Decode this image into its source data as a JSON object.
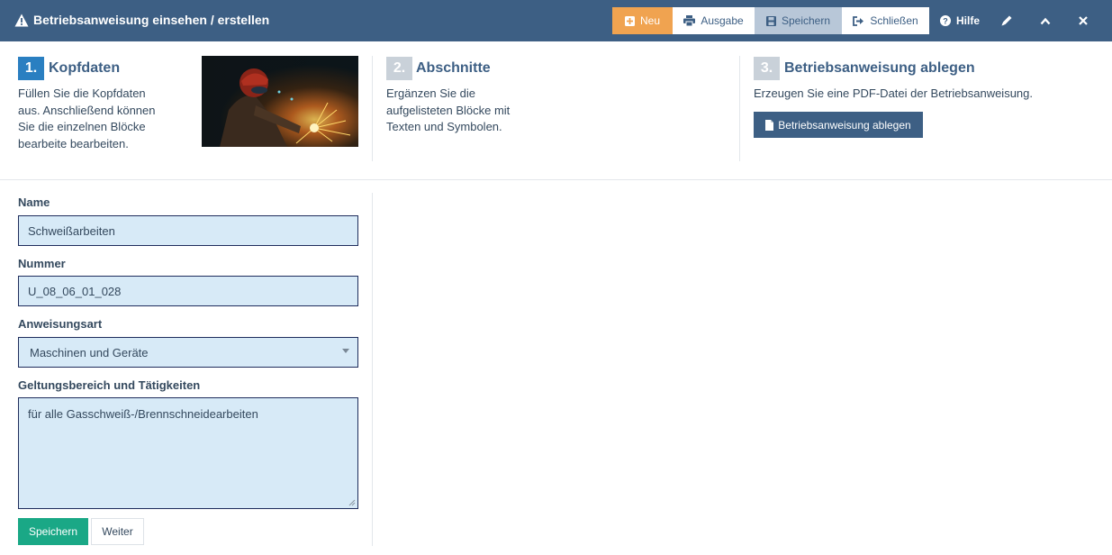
{
  "header": {
    "title": "Betriebsanweisung einsehen / erstellen",
    "buttons": {
      "neu": "Neu",
      "ausgabe": "Ausgabe",
      "speichern": "Speichern",
      "schliessen": "Schließen",
      "hilfe": "Hilfe"
    }
  },
  "steps": [
    {
      "number": "1.",
      "title": "Kopfdaten",
      "desc_lines": [
        "Füllen Sie die Kopfdaten",
        "aus. Anschließend können",
        "Sie die einzelnen Blöcke",
        "bearbeite bearbeiten."
      ],
      "active": true
    },
    {
      "number": "2.",
      "title": "Abschnitte",
      "desc_lines": [
        "Ergänzen Sie die",
        "aufgelisteten Blöcke mit",
        "Texten und Symbolen."
      ],
      "active": false
    },
    {
      "number": "3.",
      "title": "Betriebsanweisung ablegen",
      "desc_lines": [
        "Erzeugen Sie eine PDF-Datei der Betriebsanweisung."
      ],
      "active": false,
      "button": "Betriebsanweisung ablegen"
    }
  ],
  "form": {
    "name": {
      "label": "Name",
      "value": "Schweißarbeiten"
    },
    "nummer": {
      "label": "Nummer",
      "value": "U_08_06_01_028"
    },
    "anweisungsart": {
      "label": "Anweisungsart",
      "value": "Maschinen und Geräte"
    },
    "geltungsbereich": {
      "label": "Geltungsbereich und Tätigkeiten",
      "value": "für alle Gasschweiß-/Brennschneidearbeiten"
    },
    "save_button": "Speichern",
    "next_button": "Weiter"
  },
  "colors": {
    "header_bg": "#3d5f84",
    "neu_button": "#f0a350",
    "active_step": "#2a7fc1",
    "inactive_step": "#c9d1d9",
    "input_bg": "#d7eaf7",
    "save_button": "#1aa886"
  },
  "icons": [
    "warning-icon",
    "plus-icon",
    "print-icon",
    "floppy-icon",
    "sign-out-icon",
    "question-icon",
    "pencil-icon",
    "chevron-up-icon",
    "close-icon",
    "file-icon",
    "resize-grip-icon"
  ]
}
